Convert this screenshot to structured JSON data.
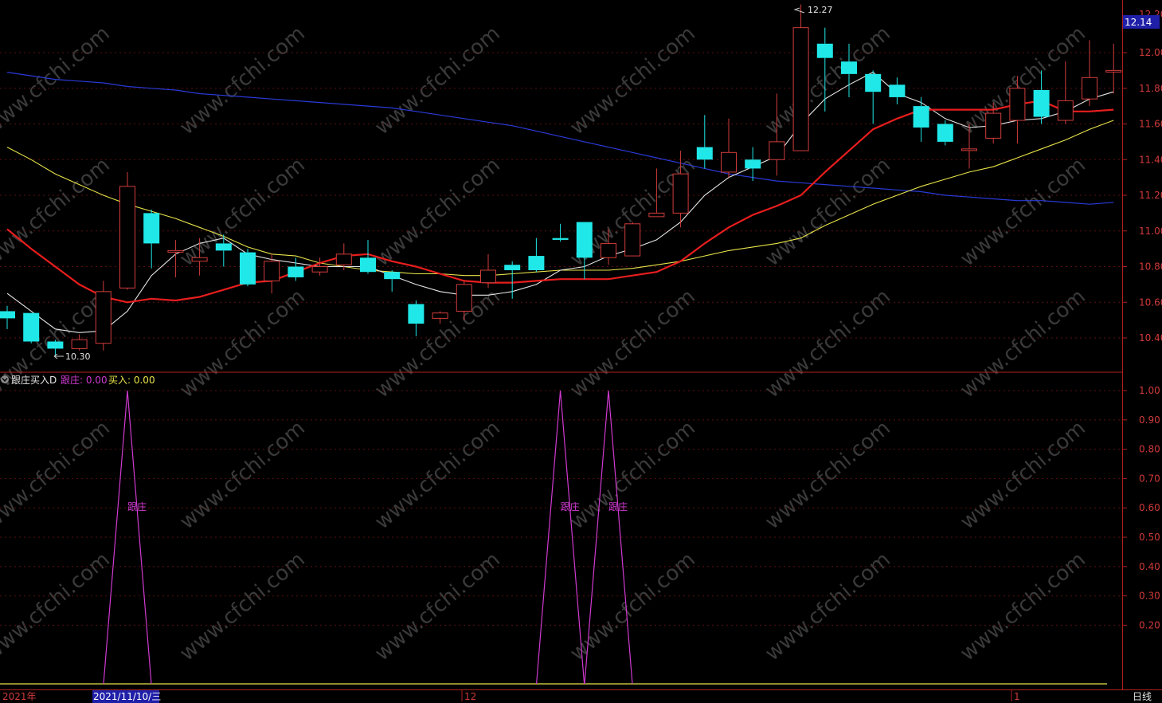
{
  "colors": {
    "background": "#000000",
    "up": "#d23c3c",
    "down": "#20e8e8",
    "ma5": "#e6e6e6",
    "ma10": "#e81d1d",
    "ma20": "#e8e34a",
    "ma60": "#2a3ad8",
    "ind_line": "#d03ad0",
    "ind_buy": "#e8e34a",
    "axis": "#b02020",
    "price_tag_bg": "#1f1fa8"
  },
  "watermark": "www.cfchi.com",
  "price_panel": {
    "last_price_tag": "12.14",
    "high_marker": "12.27",
    "low_marker": "10.30",
    "y_ticks": [
      "12.00",
      "11.80",
      "11.60",
      "11.40",
      "11.20",
      "11.00",
      "10.80",
      "10.60",
      "10.40"
    ],
    "top_cut_label": "12.20"
  },
  "indicator_panel": {
    "name": "跟庄买入D",
    "value1_label": "跟庄: 0.00",
    "value2_label": "买入: 0.00",
    "signal_label": "跟庄",
    "y_ticks": [
      "1.00",
      "0.90",
      "0.80",
      "0.70",
      "0.60",
      "0.50",
      "0.40",
      "0.30",
      "0.20"
    ]
  },
  "bottom_bar": {
    "year_label": "2021年",
    "cursor_date": "2021/11/10/三",
    "month_12": "12",
    "month_1": "1",
    "period": "日线"
  },
  "chart_data": [
    {
      "type": "candlestick",
      "title": "",
      "ylim": [
        10.22,
        12.2
      ],
      "series_candles": [
        {
          "o": 10.55,
          "c": 10.51,
          "h": 10.58,
          "l": 10.45
        },
        {
          "o": 10.54,
          "c": 10.38,
          "h": 10.54,
          "l": 10.37
        },
        {
          "o": 10.38,
          "c": 10.34,
          "h": 10.39,
          "l": 10.3
        },
        {
          "o": 10.34,
          "c": 10.39,
          "h": 10.42,
          "l": 10.33
        },
        {
          "o": 10.37,
          "c": 10.66,
          "h": 10.72,
          "l": 10.33
        },
        {
          "o": 10.68,
          "c": 11.25,
          "h": 11.33,
          "l": 10.67
        },
        {
          "o": 11.1,
          "c": 10.93,
          "h": 11.12,
          "l": 10.79
        },
        {
          "o": 10.89,
          "c": 10.89,
          "h": 10.95,
          "l": 10.74
        },
        {
          "o": 10.83,
          "c": 10.85,
          "h": 10.96,
          "l": 10.75
        },
        {
          "o": 10.93,
          "c": 10.89,
          "h": 10.98,
          "l": 10.8
        },
        {
          "o": 10.88,
          "c": 10.7,
          "h": 10.9,
          "l": 10.69
        },
        {
          "o": 10.72,
          "c": 10.83,
          "h": 10.87,
          "l": 10.65
        },
        {
          "o": 10.8,
          "c": 10.74,
          "h": 10.85,
          "l": 10.72
        },
        {
          "o": 10.77,
          "c": 10.8,
          "h": 10.85,
          "l": 10.75
        },
        {
          "o": 10.81,
          "c": 10.87,
          "h": 10.93,
          "l": 10.78
        },
        {
          "o": 10.85,
          "c": 10.77,
          "h": 10.95,
          "l": 10.76
        },
        {
          "o": 10.77,
          "c": 10.73,
          "h": 10.78,
          "l": 10.66
        },
        {
          "o": 10.59,
          "c": 10.48,
          "h": 10.61,
          "l": 10.41
        },
        {
          "o": 10.51,
          "c": 10.54,
          "h": 10.55,
          "l": 10.48
        },
        {
          "o": 10.55,
          "c": 10.7,
          "h": 10.72,
          "l": 10.5
        },
        {
          "o": 10.71,
          "c": 10.78,
          "h": 10.87,
          "l": 10.68
        },
        {
          "o": 10.81,
          "c": 10.78,
          "h": 10.83,
          "l": 10.62
        },
        {
          "o": 10.86,
          "c": 10.78,
          "h": 10.96,
          "l": 10.77
        },
        {
          "o": 10.96,
          "c": 10.95,
          "h": 11.04,
          "l": 10.94
        },
        {
          "o": 11.05,
          "c": 10.85,
          "h": 11.05,
          "l": 10.73
        },
        {
          "o": 10.85,
          "c": 10.93,
          "h": 11.01,
          "l": 10.81
        },
        {
          "o": 10.86,
          "c": 11.04,
          "h": 11.05,
          "l": 10.86
        },
        {
          "o": 11.08,
          "c": 11.1,
          "h": 11.35,
          "l": 11.08
        },
        {
          "o": 11.1,
          "c": 11.32,
          "h": 11.45,
          "l": 11.02
        },
        {
          "o": 11.47,
          "c": 11.4,
          "h": 11.65,
          "l": 11.35
        },
        {
          "o": 11.33,
          "c": 11.44,
          "h": 11.63,
          "l": 11.3
        },
        {
          "o": 11.4,
          "c": 11.35,
          "h": 11.47,
          "l": 11.28
        },
        {
          "o": 11.4,
          "c": 11.5,
          "h": 11.77,
          "l": 11.31
        },
        {
          "o": 11.45,
          "c": 12.14,
          "h": 12.27,
          "l": 11.45
        },
        {
          "o": 12.05,
          "c": 11.97,
          "h": 12.14,
          "l": 11.67
        },
        {
          "o": 11.95,
          "c": 11.88,
          "h": 12.05,
          "l": 11.75
        },
        {
          "o": 11.88,
          "c": 11.78,
          "h": 11.9,
          "l": 11.6
        },
        {
          "o": 11.82,
          "c": 11.75,
          "h": 11.86,
          "l": 11.71
        },
        {
          "o": 11.7,
          "c": 11.58,
          "h": 11.75,
          "l": 11.5
        },
        {
          "o": 11.6,
          "c": 11.5,
          "h": 11.62,
          "l": 11.48
        },
        {
          "o": 11.46,
          "c": 11.46,
          "h": 11.6,
          "l": 11.35
        },
        {
          "o": 11.52,
          "c": 11.66,
          "h": 11.72,
          "l": 11.49
        },
        {
          "o": 11.62,
          "c": 11.8,
          "h": 11.87,
          "l": 11.49
        },
        {
          "o": 11.79,
          "c": 11.64,
          "h": 11.9,
          "l": 11.6
        },
        {
          "o": 11.62,
          "c": 11.73,
          "h": 11.95,
          "l": 11.6
        },
        {
          "o": 11.74,
          "c": 11.86,
          "h": 12.07,
          "l": 11.7
        },
        {
          "o": 11.9,
          "c": 11.9,
          "h": 12.05,
          "l": 11.77
        }
      ],
      "ma5": [
        10.65,
        10.55,
        10.45,
        10.43,
        10.44,
        10.55,
        10.75,
        10.87,
        10.93,
        10.96,
        10.87,
        10.84,
        10.82,
        10.8,
        10.8,
        10.8,
        10.75,
        10.7,
        10.66,
        10.64,
        10.64,
        10.66,
        10.7,
        10.78,
        10.8,
        10.86,
        10.9,
        10.95,
        11.05,
        11.2,
        11.3,
        11.36,
        11.42,
        11.6,
        11.74,
        11.82,
        11.89,
        11.77,
        11.72,
        11.63,
        11.58,
        11.59,
        11.62,
        11.63,
        11.67,
        11.74,
        11.78
      ],
      "ma10": [
        11.01,
        10.9,
        10.8,
        10.7,
        10.63,
        10.6,
        10.62,
        10.61,
        10.63,
        10.67,
        10.71,
        10.72,
        10.77,
        10.82,
        10.86,
        10.87,
        10.83,
        10.8,
        10.76,
        10.72,
        10.71,
        10.71,
        10.72,
        10.73,
        10.73,
        10.73,
        10.75,
        10.77,
        10.83,
        10.93,
        11.02,
        11.09,
        11.14,
        11.2,
        11.33,
        11.45,
        11.57,
        11.63,
        11.68,
        11.68,
        11.68,
        11.68,
        11.71,
        11.73,
        11.67,
        11.67,
        11.68
      ],
      "ma20": [
        11.47,
        11.4,
        11.32,
        11.26,
        11.2,
        11.15,
        11.11,
        11.07,
        11.02,
        10.97,
        10.91,
        10.87,
        10.86,
        10.82,
        10.8,
        10.78,
        10.77,
        10.76,
        10.76,
        10.75,
        10.75,
        10.76,
        10.77,
        10.78,
        10.78,
        10.78,
        10.79,
        10.81,
        10.83,
        10.86,
        10.89,
        10.91,
        10.93,
        10.96,
        11.03,
        11.09,
        11.15,
        11.2,
        11.25,
        11.29,
        11.33,
        11.36,
        11.41,
        11.46,
        11.51,
        11.57,
        11.62
      ],
      "ma60": [
        11.89,
        11.87,
        11.85,
        11.84,
        11.83,
        11.81,
        11.8,
        11.79,
        11.77,
        11.76,
        11.75,
        11.74,
        11.73,
        11.72,
        11.71,
        11.7,
        11.69,
        11.67,
        11.65,
        11.63,
        11.61,
        11.59,
        11.56,
        11.53,
        11.5,
        11.47,
        11.44,
        11.41,
        11.38,
        11.35,
        11.32,
        11.3,
        11.28,
        11.27,
        11.26,
        11.25,
        11.24,
        11.23,
        11.22,
        11.2,
        11.19,
        11.18,
        11.17,
        11.17,
        11.16,
        11.15,
        11.16
      ]
    },
    {
      "type": "line",
      "title": "跟庄买入D",
      "ylim": [
        0,
        1
      ],
      "series": [
        {
          "name": "跟庄",
          "spikes_at_candle_index": [
            5,
            23,
            25
          ],
          "values_shown_at_cursor": 0.0
        },
        {
          "name": "买入",
          "values_shown_at_cursor": 0.0
        }
      ]
    }
  ]
}
